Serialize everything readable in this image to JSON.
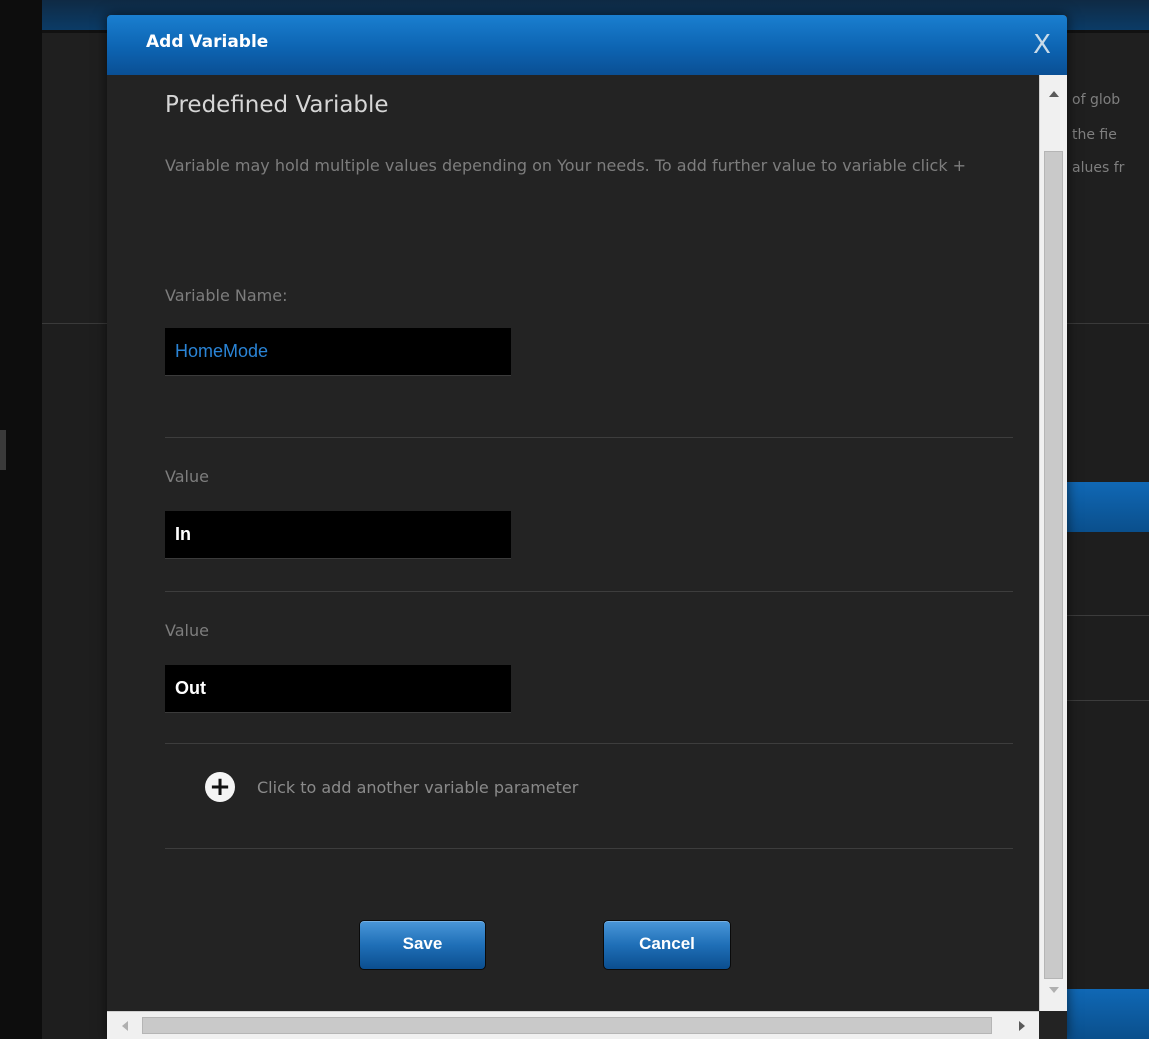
{
  "background": {
    "text_fragments": [
      "of glob",
      "the fie",
      "alues fr"
    ]
  },
  "dialog": {
    "title": "Add Variable",
    "close_label": "X",
    "heading": "Predefined Variable",
    "description": "Variable may hold multiple values depending on Your needs. To add further value to variable click +",
    "name_label": "Variable Name:",
    "name_value": "HomeMode",
    "values": [
      {
        "label": "Value",
        "value": "In"
      },
      {
        "label": "Value",
        "value": "Out"
      }
    ],
    "add_icon": "plus-circle-icon",
    "add_label": "Click to add another variable parameter",
    "save_label": "Save",
    "cancel_label": "Cancel"
  },
  "colors": {
    "accent_blue": "#0d64b2",
    "name_value_color": "#2a84d6",
    "dialog_bg": "#232323"
  }
}
